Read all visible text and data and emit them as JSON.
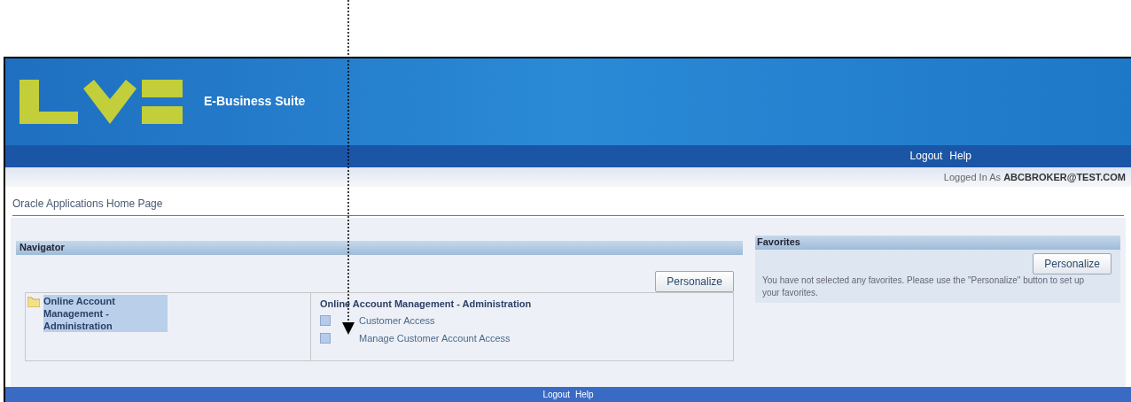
{
  "header": {
    "product": "E-Business Suite"
  },
  "global_links": [
    "Logout",
    "Help"
  ],
  "logged_in": {
    "label": "Logged In As",
    "user": "ABCBROKER@TEST.COM"
  },
  "page_title": "Oracle Applications Home Page",
  "navigator": {
    "title": "Navigator",
    "personalize_button": "Personalize",
    "responsibilities": [
      {
        "label": "Online Account Management - Administration",
        "selected": true
      }
    ],
    "section": {
      "title": "Online Account Management - Administration",
      "links": [
        "Customer Access",
        "Manage Customer Account Access"
      ]
    }
  },
  "favorites": {
    "title": "Favorites",
    "personalize_button": "Personalize",
    "message": "You have not selected any favorites. Please use the \"Personalize\" button to set up your favorites."
  },
  "footer_links": [
    "Logout",
    "Help"
  ]
}
